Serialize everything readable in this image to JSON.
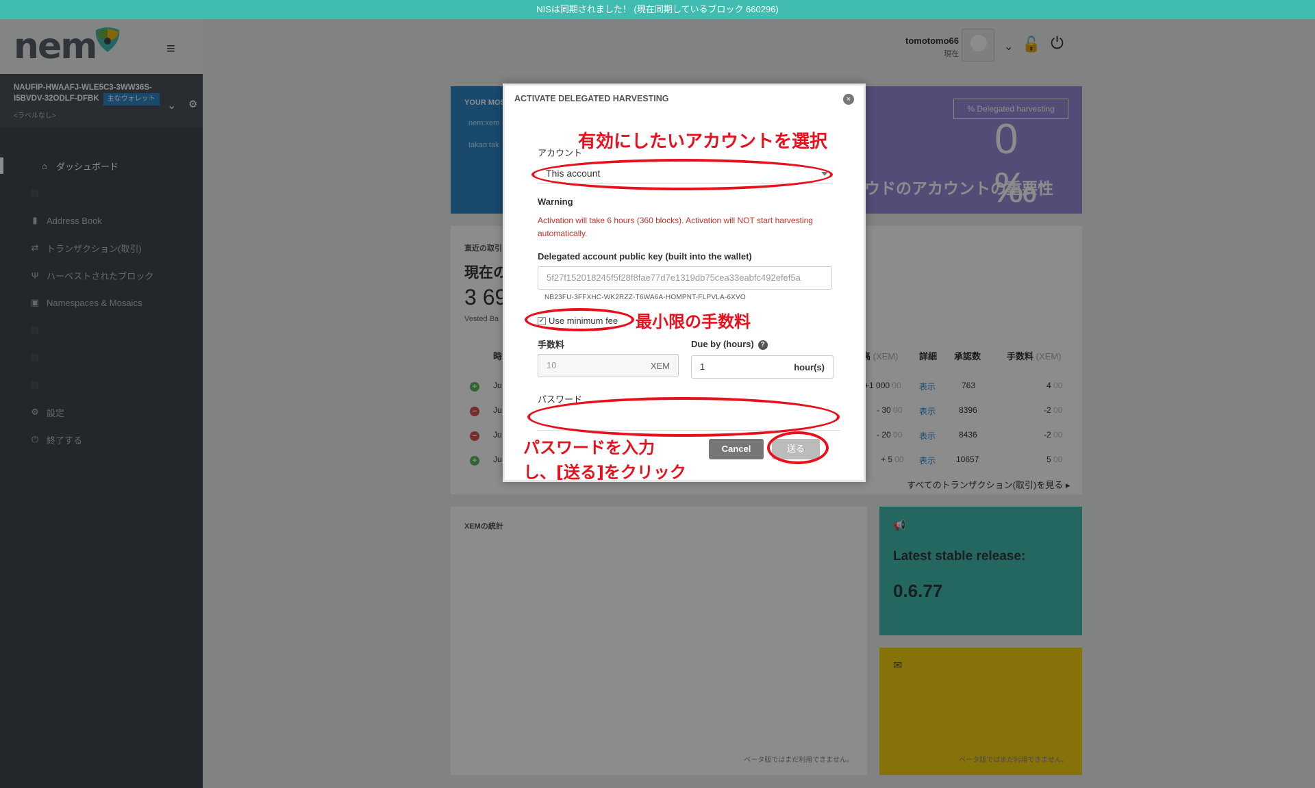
{
  "topbar": {
    "message": "NISは同期されました！ (現在同期しているブロック 660296)"
  },
  "logo": {
    "text": "nem"
  },
  "sidebar": {
    "wallet_address": "NAUFIP-HWAAFJ-WLE5C3-3WW36S-I5BVDV-32ODLF-DFBK",
    "wallet_tag": "主なウォレット",
    "wallet_label": "<ラベルなし>",
    "items": [
      {
        "label": "ダッシュボード",
        "icon": "home-icon"
      },
      {
        "label": "",
        "icon": "blank"
      },
      {
        "label": "Address Book",
        "icon": "book-icon"
      },
      {
        "label": "トランザクション(取引)",
        "icon": "exchange-icon"
      },
      {
        "label": "ハーベストされたブロック",
        "icon": "cutlery-icon"
      },
      {
        "label": "Namespaces & Mosaics",
        "icon": "briefcase-icon"
      },
      {
        "label": "",
        "icon": "blank"
      },
      {
        "label": "",
        "icon": "blank"
      },
      {
        "label": "",
        "icon": "blank"
      },
      {
        "label": "設定",
        "icon": "gears-icon"
      },
      {
        "label": "終了する",
        "icon": "power-icon"
      }
    ]
  },
  "header": {
    "username": "tomotomo66",
    "status": "現在"
  },
  "panels": {
    "blue_title": "YOUR MOS",
    "blue_line1": "nem:xem",
    "blue_line2": "takao:tak",
    "delegated_button": "Delegated harvesting",
    "importance_value": "0 ‰",
    "importance_label": "ウドのアカウントの重要性",
    "tx_small": "直近の取引",
    "tx_big": "現在の",
    "tx_num": "3 69",
    "tx_vested": "Vested Ba",
    "tx_headers": {
      "time": "時",
      "balance": "高",
      "balance_unit": "(XEM)",
      "detail": "詳細",
      "confirmations": "承認数",
      "fee": "手数料",
      "fee_unit": "(XEM)"
    },
    "tx_rows": [
      {
        "dir": "in",
        "date": "Ju",
        "amount": "+1 000",
        "amount_dec": "00",
        "detail": "表示",
        "conf": "763",
        "fee": "4",
        "fee_dec": "00"
      },
      {
        "dir": "out",
        "date": "Ju",
        "amount": "- 30",
        "amount_dec": "00",
        "detail": "表示",
        "conf": "8396",
        "fee": "-2",
        "fee_dec": "00"
      },
      {
        "dir": "out",
        "date": "Ju",
        "amount": "- 20",
        "amount_dec": "00",
        "detail": "表示",
        "conf": "8436",
        "fee": "-2",
        "fee_dec": "00"
      },
      {
        "dir": "in",
        "date": "Ju",
        "amount": "+ 5",
        "amount_dec": "00",
        "detail": "表示",
        "conf": "10657",
        "fee": "5",
        "fee_dec": "00"
      }
    ],
    "tx_all": "すべてのトランザクション(取引)を見る",
    "xem_title": "XEMの統計",
    "beta_note": "ベータ版ではまだ利用できません。",
    "release_label": "Latest stable release:",
    "release_version": "0.6.77",
    "beta_note2": "ベータ版ではまだ利用できません。"
  },
  "modal": {
    "title": "ACTIVATE DELEGATED HARVESTING",
    "account_label": "アカウント",
    "account_value": "This account",
    "warning_title": "Warning",
    "warning_text": "Activation will take 6 hours (360 blocks). Activation will NOT start harvesting automatically.",
    "pubkey_label": "Delegated account public key (built into the wallet)",
    "pubkey_value": "5f27f152018245f5f28f8fae77d7e1319db75cea33eabfc492efef5a",
    "delegated_address": "NB23FU-3FFXHC-WK2RZZ-T6WA6A-HOMPNT-FLPVLA-6XVO",
    "min_fee_label": "Use minimum fee",
    "min_fee_checked": true,
    "fee_label": "手数料",
    "fee_value": "10",
    "fee_unit": "XEM",
    "due_label": "Due by (hours)",
    "due_value": "1",
    "due_unit": "hour(s)",
    "password_label": "パスワード",
    "cancel_label": "Cancel",
    "send_label": "送る"
  },
  "annotations": {
    "select_account": "有効にしたいアカウントを選択",
    "min_fee": "最小限の手数料",
    "password_1": "パスワードを入力",
    "password_2": "し、[送る]をクリック",
    "color": "#e8101c"
  }
}
